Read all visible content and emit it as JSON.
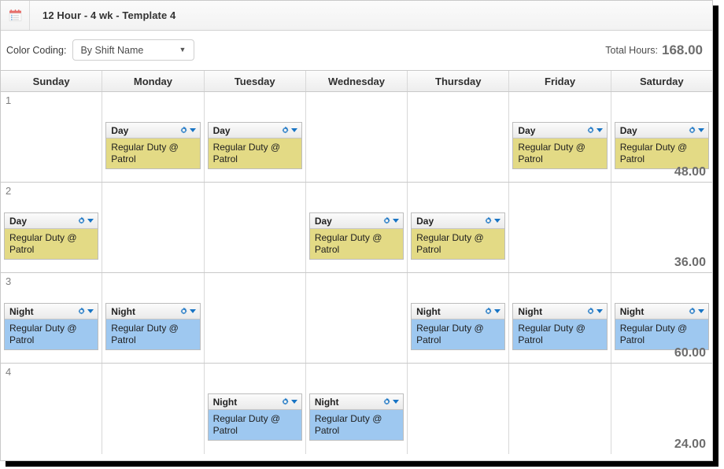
{
  "window": {
    "icon": "calendar-icon",
    "title": "12 Hour - 4 wk - Template 4"
  },
  "toolbar": {
    "color_coding_label": "Color Coding:",
    "color_coding_value": "By Shift Name",
    "color_coding_caret": "▼",
    "total_hours_label": "Total Hours:",
    "total_hours_value": "168.00"
  },
  "calendar": {
    "day_headers": [
      "Sunday",
      "Monday",
      "Tuesday",
      "Wednesday",
      "Thursday",
      "Friday",
      "Saturday"
    ],
    "shift_body_text": "Regular Duty @ Patrol",
    "gear_icon": "gear-icon",
    "caret_icon": "chevron-down-icon",
    "colors": {
      "day_shift": "#e3da85",
      "night_shift": "#9ec8f0",
      "gear": "#1874c4",
      "total_text": "#6d6d6d"
    },
    "weeks": [
      {
        "number": "1",
        "total": "48.00",
        "days": [
          {
            "shift": null
          },
          {
            "shift": {
              "name": "Day",
              "type": "day",
              "body": "Regular Duty @ Patrol"
            }
          },
          {
            "shift": {
              "name": "Day",
              "type": "day",
              "body": "Regular Duty @ Patrol"
            }
          },
          {
            "shift": null
          },
          {
            "shift": null
          },
          {
            "shift": {
              "name": "Day",
              "type": "day",
              "body": "Regular Duty @ Patrol"
            }
          },
          {
            "shift": {
              "name": "Day",
              "type": "day",
              "body": "Regular Duty @ Patrol"
            }
          }
        ]
      },
      {
        "number": "2",
        "total": "36.00",
        "days": [
          {
            "shift": {
              "name": "Day",
              "type": "day",
              "body": "Regular Duty @ Patrol"
            }
          },
          {
            "shift": null
          },
          {
            "shift": null
          },
          {
            "shift": {
              "name": "Day",
              "type": "day",
              "body": "Regular Duty @ Patrol"
            }
          },
          {
            "shift": {
              "name": "Day",
              "type": "day",
              "body": "Regular Duty @ Patrol"
            }
          },
          {
            "shift": null
          },
          {
            "shift": null
          }
        ]
      },
      {
        "number": "3",
        "total": "60.00",
        "days": [
          {
            "shift": {
              "name": "Night",
              "type": "night",
              "body": "Regular Duty @ Patrol"
            }
          },
          {
            "shift": {
              "name": "Night",
              "type": "night",
              "body": "Regular Duty @ Patrol"
            }
          },
          {
            "shift": null
          },
          {
            "shift": null
          },
          {
            "shift": {
              "name": "Night",
              "type": "night",
              "body": "Regular Duty @ Patrol"
            }
          },
          {
            "shift": {
              "name": "Night",
              "type": "night",
              "body": "Regular Duty @ Patrol"
            }
          },
          {
            "shift": {
              "name": "Night",
              "type": "night",
              "body": "Regular Duty @ Patrol"
            }
          }
        ]
      },
      {
        "number": "4",
        "total": "24.00",
        "days": [
          {
            "shift": null
          },
          {
            "shift": null
          },
          {
            "shift": {
              "name": "Night",
              "type": "night",
              "body": "Regular Duty @ Patrol"
            }
          },
          {
            "shift": {
              "name": "Night",
              "type": "night",
              "body": "Regular Duty @ Patrol"
            }
          },
          {
            "shift": null
          },
          {
            "shift": null
          },
          {
            "shift": null
          }
        ]
      }
    ]
  }
}
